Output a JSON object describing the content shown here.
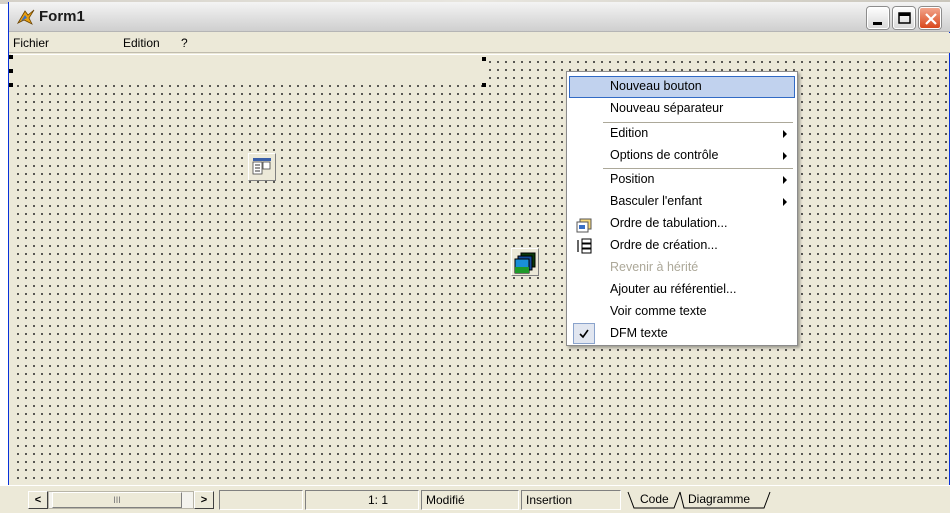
{
  "window": {
    "title": "Form1",
    "min_label": "minimize",
    "max_label": "maximize",
    "close_label": "close"
  },
  "menubar": {
    "items": [
      "Fichier",
      "Edition",
      "?"
    ]
  },
  "context_menu": {
    "items": [
      {
        "label": "Nouveau bouton",
        "highlighted": true,
        "submenu": false
      },
      {
        "label": "Nouveau séparateur",
        "submenu": false
      },
      {
        "label": "Edition",
        "submenu": true
      },
      {
        "label": "Options de contrôle",
        "submenu": true
      },
      {
        "label": "Position",
        "submenu": true
      },
      {
        "label": "Basculer l'enfant",
        "submenu": true
      },
      {
        "label": "Ordre de tabulation...",
        "icon": "tab-order-icon"
      },
      {
        "label": "Ordre de création...",
        "icon": "creation-order-icon"
      },
      {
        "label": "Revenir à hérité",
        "disabled": true
      },
      {
        "label": "Ajouter au référentiel..."
      },
      {
        "label": "Voir comme texte"
      },
      {
        "label": "DFM texte",
        "checked": true
      }
    ]
  },
  "statusbar": {
    "scroll_thumb": "III",
    "scroll_left": "<",
    "scroll_right": ">",
    "position": "1:  1",
    "modified": "Modifié",
    "mode": "Insertion",
    "tabs": [
      "Code",
      "Diagramme"
    ]
  },
  "colors": {
    "menu_highlight": "#c1d2ee",
    "menu_highlight_border": "#316ac5",
    "window_face": "#ece9d8",
    "close_button": "#d9481c"
  }
}
